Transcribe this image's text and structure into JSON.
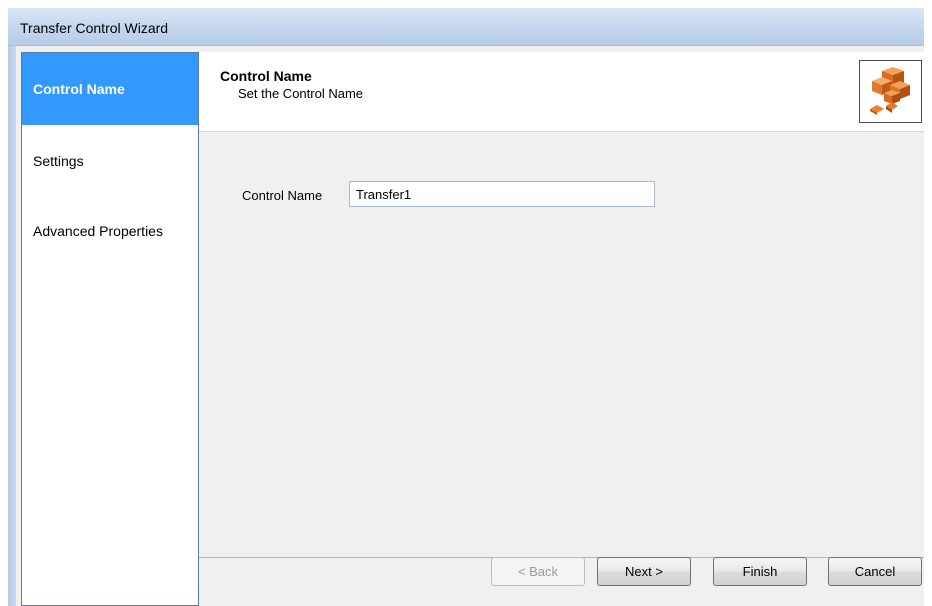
{
  "window": {
    "title": "Transfer Control Wizard"
  },
  "sidebar": {
    "items": [
      {
        "label": "Control Name",
        "active": true
      },
      {
        "label": "Settings",
        "active": false
      },
      {
        "label": "Advanced Properties",
        "active": false
      }
    ]
  },
  "header": {
    "title": "Control Name",
    "subtitle": "Set the Control Name",
    "logo_icon": "orange-cubes-icon"
  },
  "form": {
    "control_name_label": "Control Name",
    "control_name_value": "Transfer1"
  },
  "buttons": {
    "back": "< Back",
    "next": "Next >",
    "finish": "Finish",
    "cancel": "Cancel",
    "back_enabled": false
  },
  "colors": {
    "selection": "#3399ff",
    "logo_orange": "#e0782a"
  }
}
